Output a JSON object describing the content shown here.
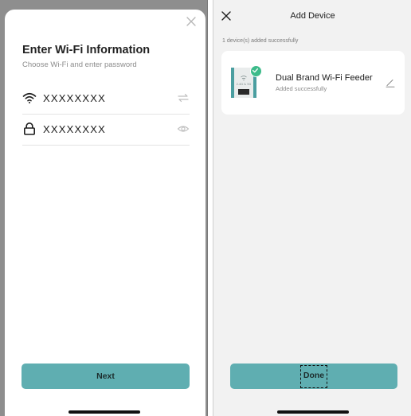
{
  "left_screen": {
    "title": "Enter Wi-Fi Information",
    "subtitle": "Choose Wi-Fi and enter password",
    "wifi_field": {
      "value": "XXXXXXXX",
      "lead_icon": "wifi-icon",
      "trail_icon": "switch-network-icon"
    },
    "password_field": {
      "value": "XXXXXXXX",
      "lead_icon": "lock-icon",
      "trail_icon": "eye-icon"
    },
    "close_icon": "close-icon",
    "next_label": "Next"
  },
  "right_screen": {
    "nav_title": "Add Device",
    "close_icon": "close-icon",
    "status_text": "1 device(s) added successfully",
    "device": {
      "name": "Dual Brand Wi-Fi Feeder",
      "status": "Added successfully",
      "thumb_label": "2.4G & 5G",
      "edit_icon": "pencil-icon"
    },
    "done_label": "Done"
  },
  "colors": {
    "accent": "#5faeb1",
    "success": "#3dbb8a",
    "overlay": "#8e8e8e",
    "page_bg": "#f2f2f2"
  }
}
